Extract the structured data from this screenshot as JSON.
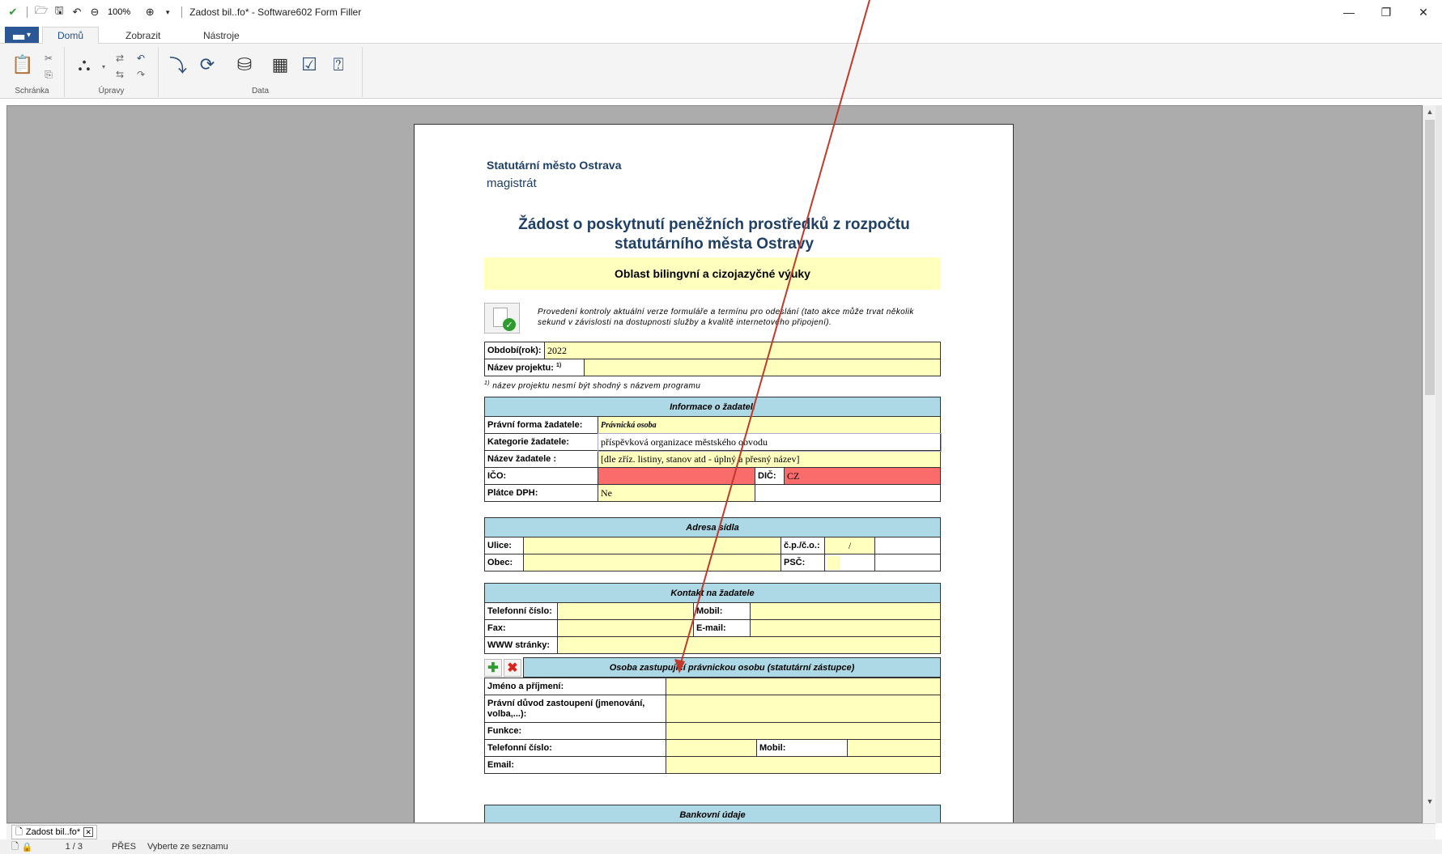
{
  "window": {
    "title": "Zadost bil..fo* - Software602 Form Filler",
    "zoom": "100%"
  },
  "ribbon": {
    "file_button": "▄▄ ▾",
    "tabs": [
      "Domů",
      "Zobrazit",
      "Nástroje"
    ],
    "groups": [
      "Schránka",
      "Úpravy",
      "Data"
    ]
  },
  "form": {
    "city": "Statutární město Ostrava",
    "office": "magistrát",
    "title_line1": "Žádost o poskytnutí peněžních prostředků z rozpočtu",
    "title_line2": "statutárního města Ostravy",
    "area": "Oblast bilingvní a cizojazyčné výuky",
    "check_note": "Provedení kontroly aktuální verze formuláře a termínu pro odeslání (tato akce může trvat několik sekund v závislosti na dostupnosti služby a kvalitě internetového připojení).",
    "period_label": "Období(rok):",
    "period_value": "2022",
    "project_label": "Název projektu:",
    "project_sup": "1)",
    "footnote_sup": "1)",
    "footnote": "název projektu nesmí být shodný s názvem programu",
    "applicant": {
      "header": "Informace o žadateli",
      "legal_form_label": "Právní forma žadatele:",
      "legal_form_value": "Právnická osoba",
      "category_label": "Kategorie žadatele:",
      "category_value": "příspěvková organizace městského obvodu",
      "name_label": "Název žadatele :",
      "name_value": "[dle zříz. listiny, stanov atd - úplný a přesný název]",
      "ico_label": "IČO:",
      "dic_label": "DIČ:",
      "dic_value": "CZ",
      "vat_label": "Plátce DPH:",
      "vat_value": "Ne"
    },
    "address": {
      "header": "Adresa sídla",
      "street_label": "Ulice:",
      "number_label": "č.p./č.o.:",
      "number_sep": "/",
      "city_label": "Obec:",
      "zip_label": "PSČ:"
    },
    "contact": {
      "header": "Kontakt na žadatele",
      "phone_label": "Telefonní číslo:",
      "mobile_label": "Mobil:",
      "fax_label": "Fax:",
      "email_label": "E-mail:",
      "web_label": "WWW stránky:"
    },
    "representative": {
      "header": "Osoba zastupující právnickou osobu (statutární zástupce)",
      "add_icon": "✚",
      "remove_icon": "✖",
      "name_label": "Jméno a příjmení:",
      "reason_label": "Právní důvod zastoupení (jmenování, volba,...):",
      "function_label": "Funkce:",
      "phone_label": "Telefonní číslo:",
      "mobile_label": "Mobil:",
      "email_label": "Email:"
    },
    "bank": {
      "header": "Bankovní údaje"
    }
  },
  "doc_tab": {
    "label": "Zadost bil..fo*"
  },
  "status": {
    "page": "1 / 3",
    "mode": "PŘES",
    "message": "Vyberte ze seznamu"
  },
  "colors": {
    "field_yellow": "#ffffbe",
    "field_red": "#fa6b6b",
    "section_blue": "#add8e6",
    "arrow": "#c0392b"
  }
}
